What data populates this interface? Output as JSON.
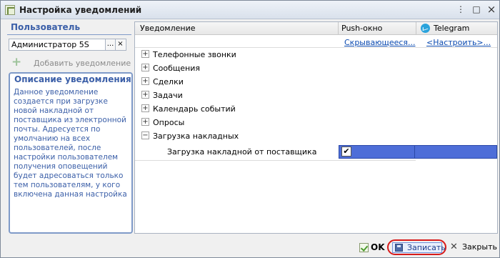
{
  "window": {
    "title": "Настройка уведомлений",
    "minimize": "⋮",
    "maximize": "□",
    "close": "×"
  },
  "left": {
    "user_label": "Пользователь",
    "user_value": "Администратор 5S",
    "add_notification": "Добавить уведомление",
    "description_title": "Описание уведомления",
    "description_text": "Данное уведомление создается при загрузке новой накладной от поставщика из электронной почты. Адресуется по умолчанию на всех пользователей, после настройки пользователем получения оповещений будет адресоваться только тем пользователям, у кого включена данная настройка"
  },
  "grid": {
    "columns": [
      "Уведомление",
      "Push-окно",
      "Telegram"
    ],
    "links": {
      "push": "Скрывающееся...",
      "telegram": "<Настроить>..."
    },
    "rows": [
      {
        "label": "Телефонные звонки",
        "expanded": false
      },
      {
        "label": "Сообщения",
        "expanded": false
      },
      {
        "label": "Сделки",
        "expanded": false
      },
      {
        "label": "Задачи",
        "expanded": false
      },
      {
        "label": "Календарь событий",
        "expanded": false
      },
      {
        "label": "Опросы",
        "expanded": false
      },
      {
        "label": "Загрузка накладных",
        "expanded": true
      }
    ],
    "child": {
      "label": "Загрузка накладной от поставщика",
      "push_checked": "✔"
    }
  },
  "buttons": {
    "ok": "OK",
    "save": "Записать",
    "close": "Закрыть"
  }
}
